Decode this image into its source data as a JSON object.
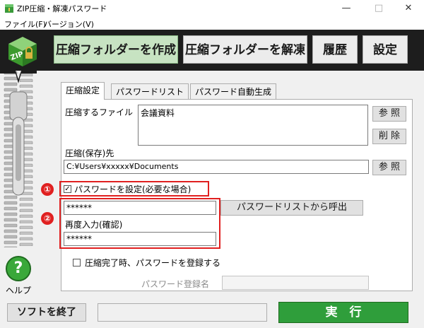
{
  "window": {
    "title": "ZIP圧縮・解凍パスワード",
    "minimize": "—",
    "maximize": "□",
    "close": "✕"
  },
  "menu": {
    "items": [
      "ファイル(F)",
      "バージョン(V)"
    ]
  },
  "toolbar": {
    "logo_text": "ZIP",
    "buttons": [
      "圧縮フォルダーを作成",
      "圧縮フォルダーを解凍",
      "履歴",
      "設定"
    ]
  },
  "tabs": [
    "圧縮設定",
    "パスワードリスト",
    "パスワード自動生成"
  ],
  "form": {
    "files_label": "圧縮するファイル",
    "files_value": "会議資料",
    "browse_files_button": "参 照",
    "delete_button": "削 除",
    "dest_label": "圧縮(保存)先",
    "dest_value": "C:¥Users¥xxxxx¥Documents",
    "browse_dest_button": "参 照",
    "set_password_label": "パスワードを設定(必要な場合)",
    "password_value": "******",
    "password_list_button": "パスワードリストから呼出",
    "confirm_label": "再度入力(確認)",
    "confirm_value": "******",
    "register_label": "圧縮完了時、パスワードを登録する",
    "register_name_label": "パスワード登録名",
    "register_name_value": ""
  },
  "annotations": [
    "①",
    "②"
  ],
  "help": {
    "icon_glyph": "?",
    "label": "ヘルプ"
  },
  "bottom": {
    "exit_button": "ソフトを終了",
    "status_value": "",
    "execute_button": "実　行"
  },
  "colors": {
    "accent_red": "#e02020",
    "execute_green": "#2f9e3b",
    "active_button": "#c7e3c2"
  }
}
